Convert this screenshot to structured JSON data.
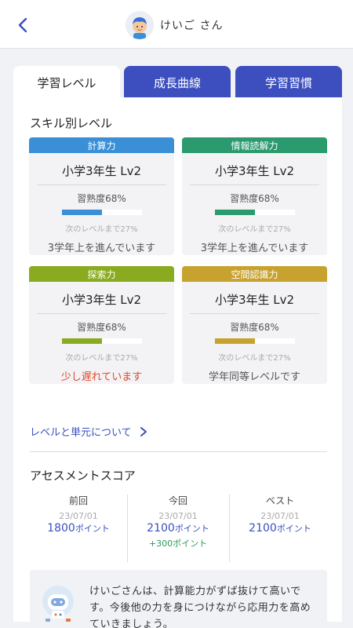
{
  "header": {
    "user_name": "けいご さん"
  },
  "tabs": [
    {
      "label": "学習レベル"
    },
    {
      "label": "成長曲線"
    },
    {
      "label": "学習習慣"
    }
  ],
  "skills_section": {
    "title": "スキル別レベル"
  },
  "skills": [
    {
      "name": "計算力",
      "level": "小学3年生 Lv2",
      "mastery": "習熟度68%",
      "mastery_value": 0.5,
      "next": "次のレベルまで27%",
      "status": "3学年上を進んでいます",
      "color": "#3a8fd6"
    },
    {
      "name": "情報読解力",
      "level": "小学3年生 Lv2",
      "mastery": "習熟度68%",
      "mastery_value": 0.5,
      "next": "次のレベルまで27%",
      "status": "3学年上を進んでいます",
      "color": "#2b9a6f"
    },
    {
      "name": "探索力",
      "level": "小学3年生 Lv2",
      "mastery": "習熟度68%",
      "mastery_value": 0.5,
      "next": "次のレベルまで27%",
      "status": "少し遅れています",
      "color": "#8aab1f"
    },
    {
      "name": "空間認識力",
      "level": "小学3年生 Lv2",
      "mastery": "習熟度68%",
      "mastery_value": 0.5,
      "next": "次のレベルまで27%",
      "status": "学年同等レベルです",
      "color": "#c8a22e"
    }
  ],
  "level_link": {
    "label": "レベルと単元について"
  },
  "assessment": {
    "title": "アセスメントスコア",
    "previous": {
      "label": "前回",
      "date": "23/07/01",
      "points": "1800",
      "unit": "ポイント"
    },
    "current": {
      "label": "今回",
      "date": "23/07/01",
      "points": "2100",
      "unit": "ポイント",
      "diff": "+300ポイント"
    },
    "best": {
      "label": "ベスト",
      "date": "23/07/01",
      "points": "2100",
      "unit": "ポイント"
    }
  },
  "comment": {
    "text": "けいごさんは、計算能力がずば抜けて高いです。今後他の力を身につけながら応用力を高めていきましょう。"
  },
  "colors": {
    "accent": "#3d4fbf",
    "late": "#e0472c",
    "positive": "#2e9a5a"
  }
}
